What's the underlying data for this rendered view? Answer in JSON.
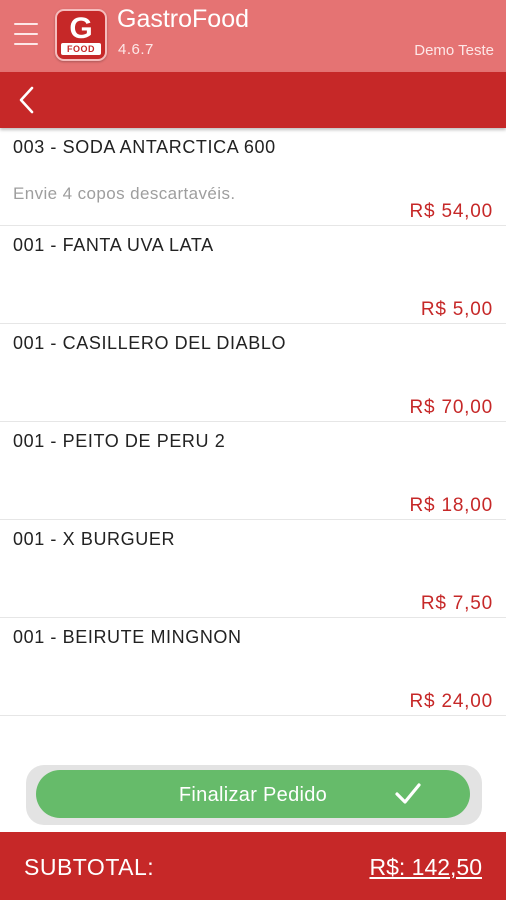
{
  "header": {
    "title": "GastroFood",
    "version": "4.6.7",
    "user": "Demo Teste",
    "logo_letter": "G",
    "logo_word": "FOOD"
  },
  "items": [
    {
      "name": "003 - SODA ANTARCTICA 600",
      "note": "Envie 4 copos descartavéis.",
      "price": "R$  54,00"
    },
    {
      "name": "001 - FANTA UVA LATA",
      "note": "",
      "price": "R$  5,00"
    },
    {
      "name": "001 - CASILLERO DEL DIABLO",
      "note": "",
      "price": "R$  70,00"
    },
    {
      "name": "001 - PEITO DE PERU 2",
      "note": "",
      "price": "R$  18,00"
    },
    {
      "name": "001 - X BURGUER",
      "note": "",
      "price": "R$  7,50"
    },
    {
      "name": "001 - BEIRUTE MINGNON",
      "note": "",
      "price": "R$  24,00"
    }
  ],
  "finalize": {
    "label": "Finalizar Pedido"
  },
  "footer": {
    "subtotal_label": "SUBTOTAL:",
    "subtotal_value": "R$: 142,50"
  },
  "colors": {
    "header": "#e57373",
    "toolbar": "#c62828",
    "price": "#c62828",
    "button": "#66bb6a"
  },
  "icons": {
    "menu": "hamburger-menu-icon",
    "back": "chevron-left-icon",
    "check": "checkmark-icon"
  }
}
